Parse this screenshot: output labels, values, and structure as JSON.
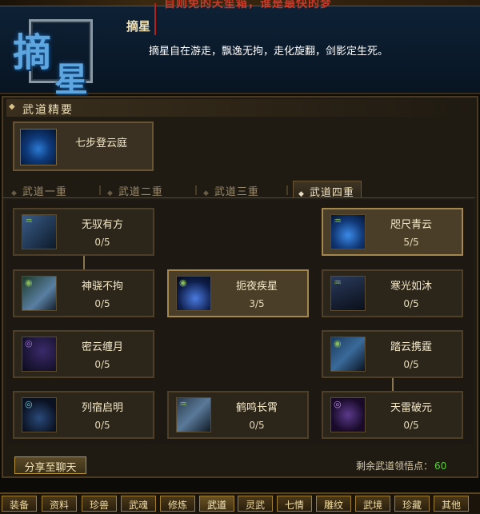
{
  "header": {
    "marquee": "自则免的天笙箱，谁是最快的梦",
    "emblem_chars": [
      "摘",
      "星"
    ],
    "skill_name": "摘星",
    "skill_desc": "摘星自在游走，飘逸无拘，走化旋翻，剑影定生死。"
  },
  "section": {
    "title": "武道精要"
  },
  "essence": {
    "label": "七步登云庭",
    "icon": "cloud-step-icon"
  },
  "tabs": [
    {
      "label": "武道一重",
      "active": false
    },
    {
      "label": "武道二重",
      "active": false
    },
    {
      "label": "武道三重",
      "active": false
    },
    {
      "label": "武道四重",
      "active": true
    }
  ],
  "nodes": [
    {
      "name": "无驭有方",
      "points": "0/5",
      "learned": false,
      "icon": "wind-blade-icon"
    },
    {
      "name": "咫尺青云",
      "points": "5/5",
      "learned": true,
      "icon": "blue-cloud-icon"
    },
    {
      "name": "神骁不拘",
      "points": "0/5",
      "learned": false,
      "icon": "swift-spirit-icon"
    },
    {
      "name": "扼夜疾星",
      "points": "3/5",
      "learned": true,
      "icon": "night-star-icon"
    },
    {
      "name": "寒光如沐",
      "points": "0/5",
      "learned": false,
      "icon": "cold-light-icon"
    },
    {
      "name": "密云缠月",
      "points": "0/5",
      "learned": false,
      "icon": "cloud-moon-icon"
    },
    {
      "name": "踏云携霆",
      "points": "0/5",
      "learned": false,
      "icon": "cloud-thunder-icon"
    },
    {
      "name": "列宿启明",
      "points": "0/5",
      "learned": false,
      "icon": "constellation-icon"
    },
    {
      "name": "鹤鸣长霄",
      "points": "0/5",
      "learned": false,
      "icon": "crane-cry-icon"
    },
    {
      "name": "天雷破元",
      "points": "0/5",
      "learned": false,
      "icon": "heaven-thunder-icon"
    }
  ],
  "footer": {
    "share_label": "分享至聊天",
    "remain_label": "剩余武道领悟点：",
    "remain_value": "60"
  },
  "bottom_bar": [
    "装备",
    "资料",
    "珍兽",
    "武魂",
    "修炼",
    "武道",
    "灵武",
    "七情",
    "雕纹",
    "武境",
    "珍藏",
    "其他"
  ],
  "bottom_bar_selected": "武道",
  "colors": {
    "accent": "#a4874d",
    "highlight_green": "#5bd03a",
    "emblem_blue": "#5ea6e0"
  }
}
